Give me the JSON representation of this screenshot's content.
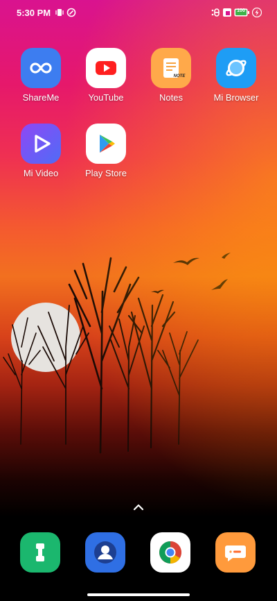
{
  "status_bar": {
    "time": "5:30 PM",
    "battery": "100"
  },
  "apps": [
    {
      "label": "ShareMe",
      "icon": "shareme-infinity-icon"
    },
    {
      "label": "YouTube",
      "icon": "youtube-play-icon"
    },
    {
      "label": "Notes",
      "icon": "notes-icon",
      "badge": "NOTE"
    },
    {
      "label": "Mi Browser",
      "icon": "globe-icon"
    },
    {
      "label": "Mi Video",
      "icon": "play-outline-icon"
    },
    {
      "label": "Play Store",
      "icon": "play-store-triangle-icon"
    }
  ],
  "dock": [
    {
      "name": "phone",
      "icon": "phone-handset-icon",
      "color": "#1bb76e"
    },
    {
      "name": "contacts",
      "icon": "contact-person-icon",
      "color": "#2f6fe4"
    },
    {
      "name": "chrome",
      "icon": "chrome-icon",
      "color": "#ffffff"
    },
    {
      "name": "messages",
      "icon": "chat-bubble-icon",
      "color": "#ff9a3c"
    }
  ],
  "colors": {
    "shareme": "#3d7df0",
    "youtube_red": "#ff1f1f",
    "notes": "#ffa94a",
    "mi_browser": "#1e9df5",
    "mi_video": "#6b5cf6"
  }
}
